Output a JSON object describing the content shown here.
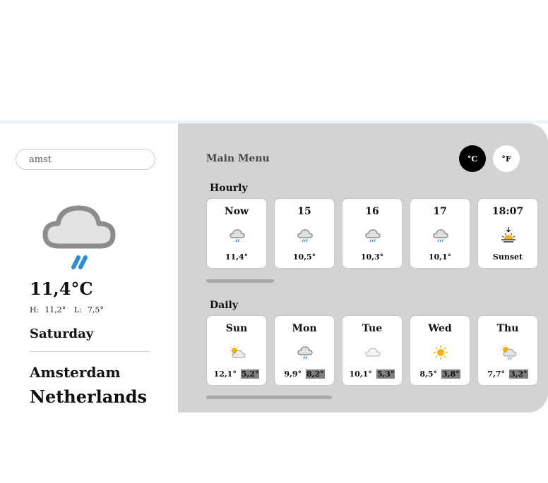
{
  "search": {
    "value": "amst"
  },
  "current": {
    "temp": "11,4°C",
    "high_label": "H:",
    "high": "11,2°",
    "low_label": "L:",
    "low": "7,5°",
    "day": "Saturday",
    "city": "Amsterdam",
    "country": "Netherlands",
    "icon": "cloud-rain-icon"
  },
  "main": {
    "title": "Main Menu",
    "units": {
      "celsius": "°C",
      "fahrenheit": "°F",
      "selected": "celsius"
    },
    "hourly_label": "Hourly",
    "daily_label": "Daily",
    "hourly": [
      {
        "time": "Now",
        "icon": "cloud-rain-icon",
        "temp": "11,4°"
      },
      {
        "time": "15",
        "icon": "cloud-rain-icon",
        "temp": "10,5°"
      },
      {
        "time": "16",
        "icon": "cloud-rain-icon",
        "temp": "10,3°"
      },
      {
        "time": "17",
        "icon": "cloud-rain-icon",
        "temp": "10,1°"
      },
      {
        "time": "18:07",
        "icon": "sunset-icon",
        "temp": "Sunset"
      }
    ],
    "daily": [
      {
        "day": "Sun",
        "icon": "partly-cloudy-icon",
        "high": "12,1°",
        "low": "5,2°"
      },
      {
        "day": "Mon",
        "icon": "cloud-rain-icon",
        "high": "9,9°",
        "low": "8,2°"
      },
      {
        "day": "Tue",
        "icon": "cloud-icon",
        "high": "10,1°",
        "low": "5,3°"
      },
      {
        "day": "Wed",
        "icon": "sun-icon",
        "high": "8,5°",
        "low": "3,8°"
      },
      {
        "day": "Thu",
        "icon": "partly-cloudy-rain-icon",
        "high": "7,7°",
        "low": "3,2°"
      }
    ],
    "colors": {
      "rain": "#2b8de0",
      "sun": "#f5b400",
      "cloud": "#d9d9d9"
    }
  }
}
